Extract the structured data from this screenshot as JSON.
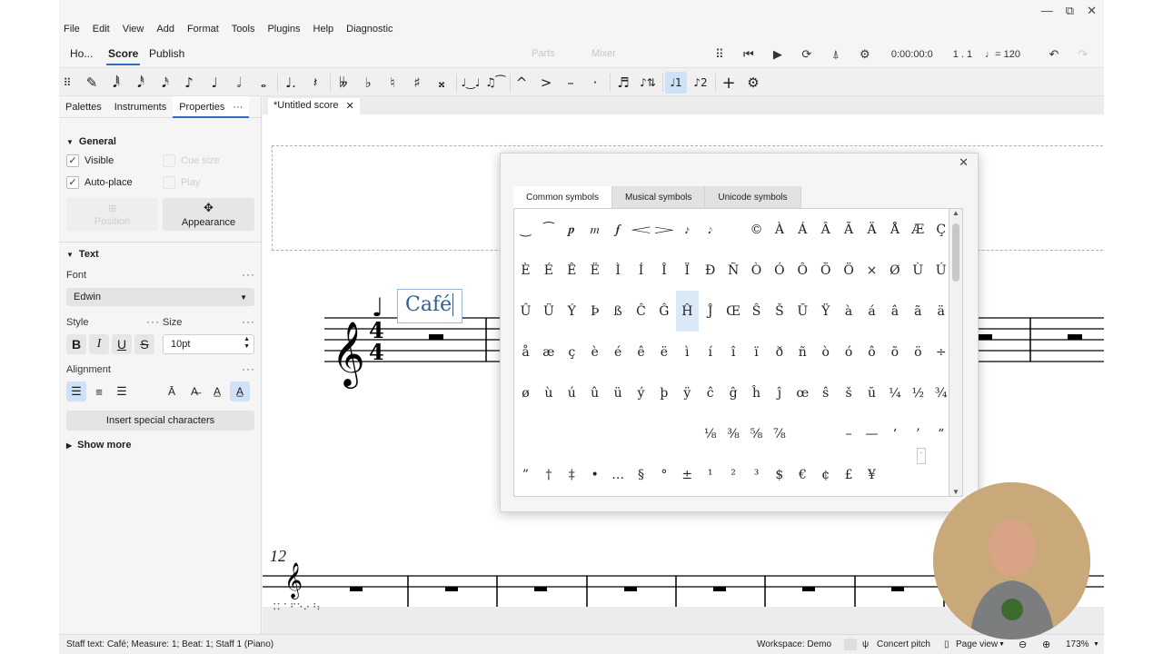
{
  "window": {
    "minimize": "—",
    "restore": "⧉",
    "close": "✕"
  },
  "menu": [
    "File",
    "Edit",
    "View",
    "Add",
    "Format",
    "Tools",
    "Plugins",
    "Help",
    "Diagnostic"
  ],
  "top_tabs": {
    "home": "Ho...",
    "score": "Score",
    "publish": "Publish",
    "parts": "Parts",
    "mixer": "Mixer"
  },
  "playback": {
    "time": "0:00:00:0",
    "position": "1 . 1",
    "tempo": "= 120",
    "tempo_glyph": "♩"
  },
  "note_toolbar": {
    "drag": "⠿",
    "pencil": "✎",
    "n64": "𝅘𝅥𝅱",
    "n32": "𝅘𝅥𝅰",
    "n16": "𝅘𝅥𝅯",
    "n8": "♪",
    "n4": "♩",
    "n2": "𝅗𝅥",
    "n1": "𝅝",
    "dot": "♩.",
    "rest": "𝄽",
    "dflat": "𝄫",
    "flat": "♭",
    "natural": "♮",
    "sharp": "♯",
    "dsharp": "𝄪",
    "tie": "♩‿♩",
    "slur": "♫⁀",
    "marcato": "^",
    "accent": ">",
    "tenuto": "–",
    "staccato": "·",
    "tuplet": "♬",
    "flip": "♪⇅",
    "voice1": "♩1",
    "voice2": "♪2",
    "add": "+",
    "settings": "⚙"
  },
  "panel": {
    "tabs": {
      "palettes": "Palettes",
      "instruments": "Instruments",
      "properties": "Properties",
      "more": "···"
    },
    "general": {
      "title": "General",
      "visible": "Visible",
      "cuesize": "Cue size",
      "autoplace": "Auto-place",
      "play": "Play",
      "position": "Position",
      "appearance": "Appearance",
      "check": "✓"
    },
    "text": {
      "title": "Text",
      "font_label": "Font",
      "font_value": "Edwin",
      "style_label": "Style",
      "size_label": "Size",
      "size_value": "10pt",
      "bold": "B",
      "italic": "I",
      "underline": "U",
      "strike": "S",
      "alignment_label": "Alignment",
      "insert": "Insert special characters",
      "show_more": "Show more",
      "dots": "···"
    }
  },
  "score": {
    "doc_tab": "*Untitled score",
    "close": "✕",
    "measure_number": "12",
    "staff_text": "Café",
    "braille": "⠨⠅⠁⠋⠑⠔⠘⠆"
  },
  "status": {
    "info": "Staff text: Café; Measure: 1; Beat: 1; Staff 1 (Piano)",
    "workspace": "Workspace: Demo",
    "concert": "Concert pitch",
    "view": "Page view",
    "zoom": "173%"
  },
  "dialog": {
    "close": "✕",
    "tabs": {
      "common": "Common symbols",
      "musical": "Musical symbols",
      "unicode": "Unicode symbols"
    },
    "rows": [
      [
        "‿",
        "⁀",
        "𝆏",
        "𝆐",
        "𝆑",
        "𝆒",
        "𝆓",
        "𝆔",
        "𝆕",
        "",
        "©",
        "À",
        "Á",
        "Â",
        "Ã",
        "Ä",
        "Å",
        "Æ",
        "Ç"
      ],
      [
        "È",
        "É",
        "Ê",
        "Ë",
        "Ì",
        "Í",
        "Î",
        "Ï",
        "Ð",
        "Ñ",
        "Ò",
        "Ó",
        "Ô",
        "Õ",
        "Ö",
        "×",
        "Ø",
        "Ù",
        "Ú"
      ],
      [
        "Û",
        "Ü",
        "Ý",
        "Þ",
        "ß",
        "Ĉ",
        "Ĝ",
        "Ĥ",
        "Ĵ",
        "Œ",
        "Ŝ",
        "Š",
        "Ŭ",
        "Ÿ",
        "à",
        "á",
        "â",
        "ã",
        "ä"
      ],
      [
        "å",
        "æ",
        "ç",
        "è",
        "é",
        "ê",
        "ë",
        "ì",
        "í",
        "î",
        "ï",
        "ð",
        "ñ",
        "ò",
        "ó",
        "ô",
        "õ",
        "ö",
        "÷"
      ],
      [
        "ø",
        "ù",
        "ú",
        "û",
        "ü",
        "ý",
        "þ",
        "ÿ",
        "ĉ",
        "ĝ",
        "ĥ",
        "ĵ",
        "œ",
        "ŝ",
        "š",
        "ŭ",
        "¼",
        "½",
        "¾"
      ],
      [
        "",
        "",
        "",
        "",
        "",
        "",
        "",
        "",
        "⅛",
        "⅜",
        "⅝",
        "⅞",
        "",
        "",
        "–",
        "—",
        "‘",
        "’",
        "“"
      ],
      [
        "”",
        "†",
        "‡",
        "•",
        "…",
        "§",
        "°",
        "±",
        "¹",
        "²",
        "³",
        "$",
        "€",
        "¢",
        "£",
        "¥",
        "",
        "",
        ""
      ]
    ],
    "highlighted": "Ĥ"
  },
  "colors": {
    "accent": "#2d6ec8",
    "selection": "#cfe1f7"
  }
}
